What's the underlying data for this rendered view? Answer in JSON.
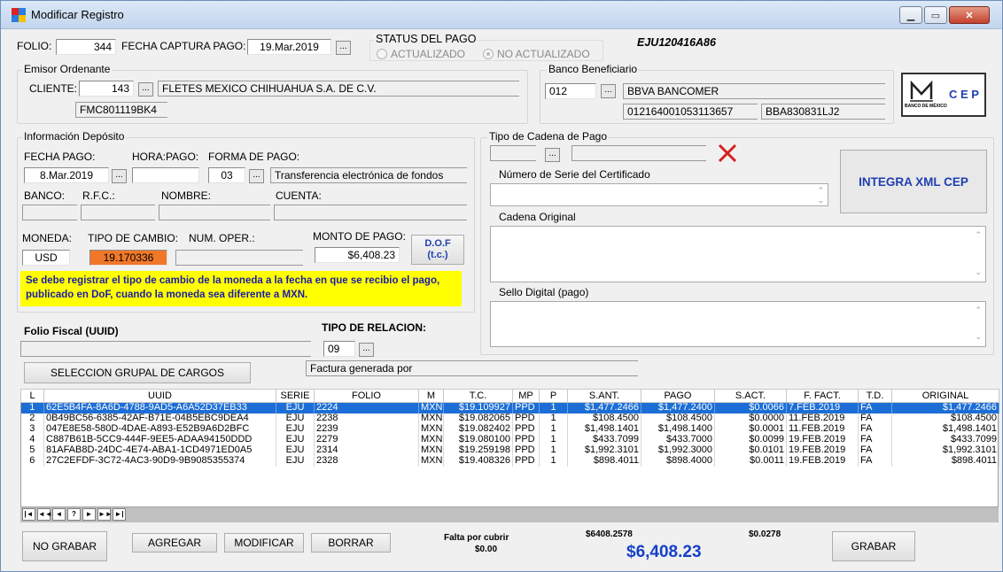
{
  "window": {
    "title": "Modificar Registro"
  },
  "header": {
    "folio_label": "FOLIO:",
    "folio_value": "344",
    "fecha_captura_label": "FECHA CAPTURA PAGO:",
    "fecha_captura_value": "19.Mar.2019",
    "status_title": "STATUS DEL PAGO",
    "status_actualizado": "ACTUALIZADO",
    "status_no_actualizado": "NO ACTUALIZADO",
    "rfc_emisor": "EJU120416A86"
  },
  "emisor": {
    "title": "Emisor Ordenante",
    "cliente_label": "CLIENTE:",
    "cliente_value": "143",
    "cliente_nombre": "FLETES MEXICO CHIHUAHUA S.A. DE C.V.",
    "cliente_rfc": "FMC801119BK4"
  },
  "banco_beneficiario": {
    "title": "Banco Beneficiario",
    "codigo": "012",
    "nombre": "BBVA BANCOMER",
    "cuenta": "012164001053113657",
    "rfc": "BBA830831LJ2"
  },
  "cep_logo": {
    "small_text": "BANCO DE MÉXICO",
    "big_text": "C E P"
  },
  "deposito": {
    "title": "Información Depósito",
    "fecha_pago_label": "FECHA PAGO:",
    "fecha_pago_value": "8.Mar.2019",
    "hora_pago_label": "HORA:PAGO:",
    "forma_pago_label": "FORMA DE PAGO:",
    "forma_pago_codigo": "03",
    "forma_pago_desc": "Transferencia electrónica de fondos",
    "banco_label": "BANCO:",
    "rfc_label": "R.F.C.:",
    "nombre_label": "NOMBRE:",
    "cuenta_label": "CUENTA:",
    "moneda_label": "MONEDA:",
    "moneda_value": "USD",
    "tipo_cambio_label": "TIPO DE CAMBIO:",
    "tipo_cambio_value": "19.170336",
    "num_oper_label": "NUM. OPER.:",
    "monto_label": "MONTO DE PAGO:",
    "monto_value": "$6,408.23",
    "dof_button_line1": "D.O.F",
    "dof_button_line2": "(t.c.)",
    "aviso": "Se debe registrar el tipo de cambio de la moneda a la fecha en que se recibio el pago, publicado en DoF, cuando la moneda sea diferente a MXN."
  },
  "folio_fiscal": {
    "label": "Folio Fiscal (UUID)",
    "tipo_relacion_label": "TIPO DE RELACION:",
    "tipo_relacion_codigo": "09",
    "tipo_relacion_desc": "Factura generada por",
    "seleccion_button": "SELECCION GRUPAL DE CARGOS"
  },
  "cadena": {
    "title": "Tipo de Cadena de Pago",
    "num_serie_label": "Número de Serie del Certificado",
    "cadena_original_label": "Cadena Original",
    "sello_label": "Sello Digital (pago)",
    "integra_button": "INTEGRA XML CEP"
  },
  "grid": {
    "columns": [
      "L",
      "UUID",
      "SERIE",
      "FOLIO",
      "M",
      "T.C.",
      "MP",
      "P",
      "S.ANT.",
      "PAGO",
      "S.ACT.",
      "F. FACT.",
      "T.D.",
      "ORIGINAL"
    ],
    "rows": [
      [
        "1",
        "62E5B4FA-8A6D-4788-9AD5-A6A52D37EB33",
        "EJU",
        "2224",
        "MXN",
        "$19.109927",
        "PPD",
        "1",
        "$1,477.2466",
        "$1,477.2400",
        "$0.0066",
        "7.FEB.2019",
        "FA",
        "$1,477.2466"
      ],
      [
        "2",
        "0B49BC56-6385-42AF-B71E-04B5EBC9DEA4",
        "EJU",
        "2238",
        "MXN",
        "$19.082065",
        "PPD",
        "1",
        "$108.4500",
        "$108.4500",
        "$0.0000",
        "11.FEB.2019",
        "FA",
        "$108.4500"
      ],
      [
        "3",
        "047E8E58-580D-4DAE-A893-E52B9A6D2BFC",
        "EJU",
        "2239",
        "MXN",
        "$19.082402",
        "PPD",
        "1",
        "$1,498.1401",
        "$1,498.1400",
        "$0.0001",
        "11.FEB.2019",
        "FA",
        "$1,498.1401"
      ],
      [
        "4",
        "C887B61B-5CC9-444F-9EE5-ADAA94150DDD",
        "EJU",
        "2279",
        "MXN",
        "$19.080100",
        "PPD",
        "1",
        "$433.7099",
        "$433.7000",
        "$0.0099",
        "19.FEB.2019",
        "FA",
        "$433.7099"
      ],
      [
        "5",
        "81AFAB8D-24DC-4E74-ABA1-1CD4971ED0A5",
        "EJU",
        "2314",
        "MXN",
        "$19.259198",
        "PPD",
        "1",
        "$1,992.3101",
        "$1,992.3000",
        "$0.0101",
        "19.FEB.2019",
        "FA",
        "$1,992.3101"
      ],
      [
        "6",
        "27C2EFDF-3C72-4AC3-90D9-9B9085355374",
        "EJU",
        "2328",
        "MXN",
        "$19.408326",
        "PPD",
        "1",
        "$898.4011",
        "$898.4000",
        "$0.0011",
        "19.FEB.2019",
        "FA",
        "$898.4011"
      ]
    ],
    "selected_row": 0,
    "nav": [
      "|◄",
      "◄◄",
      "◄",
      "?",
      "►",
      "►►",
      "►|"
    ]
  },
  "footer": {
    "no_grabar": "NO GRABAR",
    "agregar": "AGREGAR",
    "modificar": "MODIFICAR",
    "borrar": "BORRAR",
    "falta_label": "Falta por cubrir",
    "falta_value": "$0.00",
    "total_sant": "$6408.2578",
    "total_sact": "$0.0278",
    "total_pago": "$6,408.23",
    "grabar": "GRABAR"
  },
  "colors": {
    "selected_row": "#1c6ed6",
    "tipo_cambio_bg": "#f07828",
    "aviso_bg": "#ffff00",
    "aviso_text": "#1b1baa",
    "cep_blue": "#1f3fb0",
    "total_blue": "#1540c8",
    "x_red": "#d62020"
  }
}
